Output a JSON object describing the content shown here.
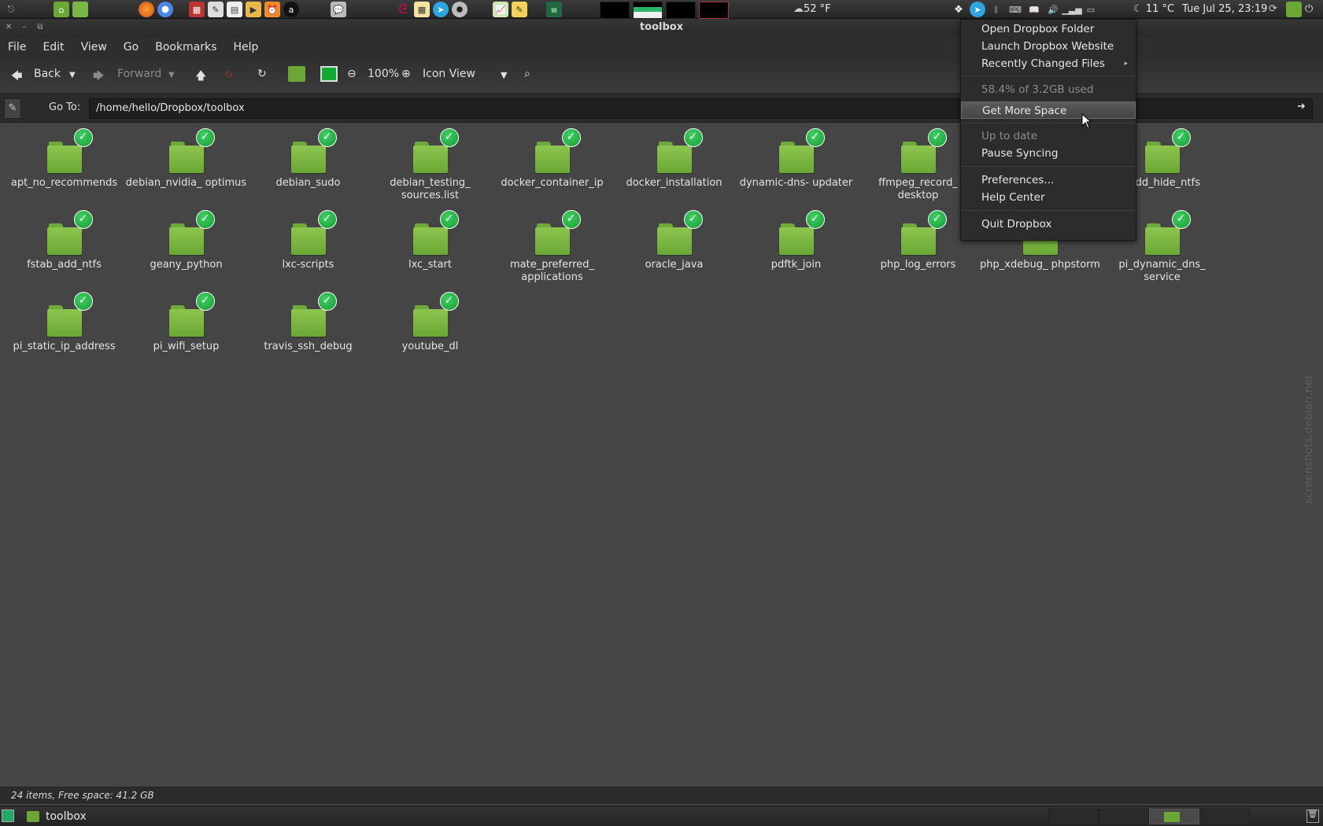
{
  "top_panel": {
    "weather": "52 °F",
    "temperature": "11 °C",
    "datetime": "Tue Jul 25, 23:19"
  },
  "window": {
    "title": "toolbox"
  },
  "menubar": {
    "items": [
      "File",
      "Edit",
      "View",
      "Go",
      "Bookmarks",
      "Help"
    ]
  },
  "toolbar": {
    "back_label": "Back",
    "forward_label": "Forward",
    "zoom_level": "100%",
    "view_mode": "Icon View"
  },
  "location": {
    "label": "Go To:",
    "path": "/home/hello/Dropbox/toolbox"
  },
  "files": [
    {
      "name": "apt_no_recommends"
    },
    {
      "name": "debian_nvidia_ optimus"
    },
    {
      "name": "debian_sudo"
    },
    {
      "name": "debian_testing_ sources.list"
    },
    {
      "name": "docker_container_ip"
    },
    {
      "name": "docker_installation"
    },
    {
      "name": "dynamic-dns- updater"
    },
    {
      "name": "ffmpeg_record_ desktop"
    },
    {
      "name": ""
    },
    {
      "name": "_add_hide_ntfs"
    },
    {
      "name": "fstab_add_ntfs"
    },
    {
      "name": "geany_python"
    },
    {
      "name": "lxc-scripts"
    },
    {
      "name": "lxc_start"
    },
    {
      "name": "mate_preferred_ applications"
    },
    {
      "name": "oracle_java"
    },
    {
      "name": "pdftk_join"
    },
    {
      "name": "php_log_errors"
    },
    {
      "name": "php_xdebug_ phpstorm"
    },
    {
      "name": "pi_dynamic_dns_ service"
    },
    {
      "name": "pi_static_ip_address"
    },
    {
      "name": "pi_wifi_setup"
    },
    {
      "name": "travis_ssh_debug"
    },
    {
      "name": "youtube_dl"
    }
  ],
  "dropbox_menu": {
    "open_folder": "Open Dropbox Folder",
    "launch_website": "Launch Dropbox Website",
    "recent_files": "Recently Changed Files",
    "usage": "58.4% of 3.2GB used",
    "get_more_space": "Get More Space",
    "status": "Up to date",
    "pause": "Pause Syncing",
    "preferences": "Preferences...",
    "help_center": "Help Center",
    "quit": "Quit Dropbox"
  },
  "statusbar": {
    "text": "24 items, Free space: 41.2 GB"
  },
  "taskbar": {
    "window_label": "toolbox"
  },
  "watermark": "screenshots.debian.net"
}
